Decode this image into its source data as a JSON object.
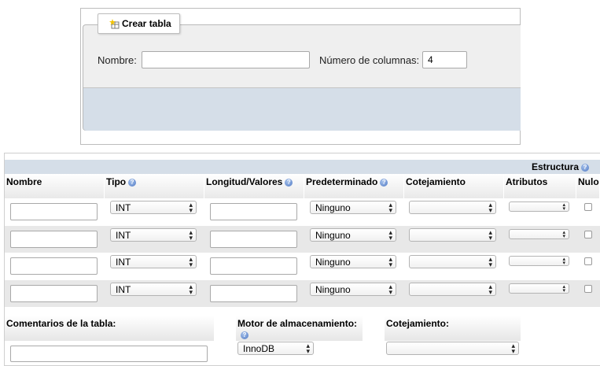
{
  "create_table": {
    "legend": "Crear tabla",
    "name_label": "Nombre:",
    "name_value": "",
    "columns_label": "Número de columnas:",
    "columns_value": "4"
  },
  "structure": {
    "title": "Estructura",
    "headers": [
      "Nombre",
      "Tipo",
      "Longitud/Valores",
      "Predeterminado",
      "Cotejamiento",
      "Atributos",
      "Nulo"
    ],
    "rows": [
      {
        "type": "INT",
        "default": "Ninguno",
        "collation": "",
        "attributes": ""
      },
      {
        "type": "INT",
        "default": "Ninguno",
        "collation": "",
        "attributes": ""
      },
      {
        "type": "INT",
        "default": "Ninguno",
        "collation": "",
        "attributes": ""
      },
      {
        "type": "INT",
        "default": "Ninguno",
        "collation": "",
        "attributes": ""
      }
    ]
  },
  "footer": {
    "comments_label": "Comentarios de la tabla:",
    "engine_label": "Motor de almacenamiento:",
    "engine_value": "InnoDB",
    "collation_label": "Cotejamiento:",
    "collation_value": ""
  }
}
